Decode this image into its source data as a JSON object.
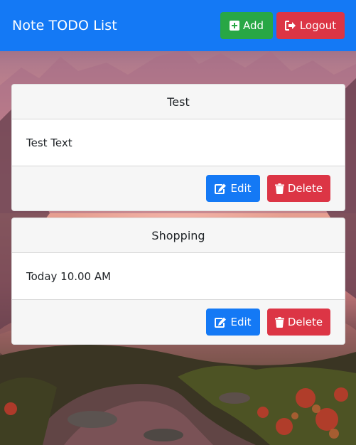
{
  "navbar": {
    "brand": "Note TODO List",
    "add_label": "Add",
    "logout_label": "Logout"
  },
  "notes": [
    {
      "title": "Test",
      "text": "Test Text",
      "edit_label": "Edit",
      "delete_label": "Delete"
    },
    {
      "title": "Shopping",
      "text": "Today 10.00 AM",
      "edit_label": "Edit",
      "delete_label": "Delete"
    }
  ],
  "colors": {
    "primary": "#1479f5",
    "success": "#28a745",
    "danger": "#dc3545"
  },
  "icons": {
    "add": "plus-square-icon",
    "logout": "sign-out-icon",
    "edit": "edit-icon",
    "delete": "trash-icon"
  }
}
